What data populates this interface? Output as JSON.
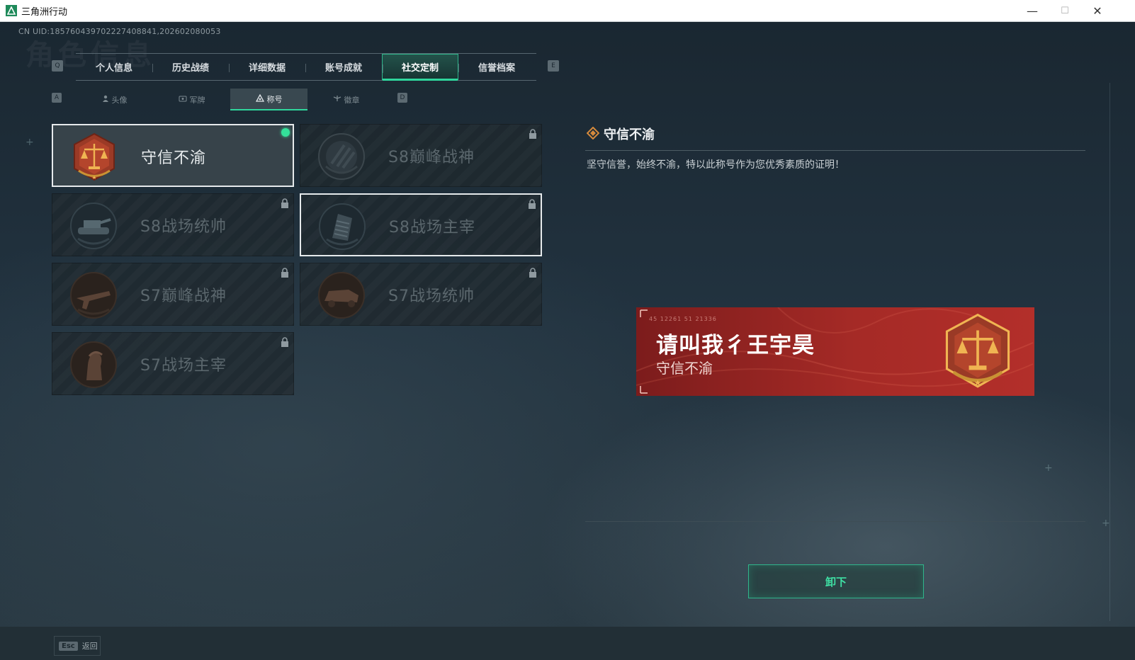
{
  "window": {
    "title": "三角洲行动",
    "minimize": "—",
    "maximize": "☐",
    "close": "✕"
  },
  "uid": "CN UID:185760439702227408841,202602080053",
  "watermark": "角色信息",
  "top_tabs": {
    "key_left": "Q",
    "key_right": "E",
    "items": [
      {
        "label": "个人信息"
      },
      {
        "label": "历史战绩"
      },
      {
        "label": "详细数据"
      },
      {
        "label": "账号成就"
      },
      {
        "label": "社交定制",
        "active": true
      },
      {
        "label": "信誉档案"
      }
    ]
  },
  "sub_tabs": {
    "key_left": "A",
    "key_right": "D",
    "items": [
      {
        "label": "头像",
        "icon": "person-icon"
      },
      {
        "label": "军牌",
        "icon": "dogtag-icon"
      },
      {
        "label": "称号",
        "icon": "badge-triangle-icon",
        "active": true
      },
      {
        "label": "徽章",
        "icon": "emblem-icon"
      }
    ]
  },
  "titles": [
    {
      "name": "守信不渝",
      "medal": "scales-medal-icon",
      "equipped": true,
      "locked": false
    },
    {
      "name": "S8巅峰战神",
      "medal": "stripes-medal-icon",
      "locked": true
    },
    {
      "name": "S8战场统帅",
      "medal": "tank-medal-icon",
      "locked": true
    },
    {
      "name": "S8战场主宰",
      "medal": "building-medal-icon",
      "locked": true,
      "hovered": true
    },
    {
      "name": "S7巅峰战神",
      "medal": "rifle-medal-icon",
      "locked": true
    },
    {
      "name": "S7战场统帅",
      "medal": "vehicle-medal-icon",
      "locked": true
    },
    {
      "name": "S7战场主宰",
      "medal": "soldier-medal-icon",
      "locked": true
    }
  ],
  "detail": {
    "title": "守信不渝",
    "description": "坚守信誉，始终不渝，特以此称号作为您优秀素质的证明！"
  },
  "nameplate": {
    "player_name": "请叫我彳王宇昊",
    "title": "守信不渝",
    "coords": "45 12261   51 21336"
  },
  "actions": {
    "unequip": "卸下"
  },
  "footer": {
    "esc_key": "Esc",
    "esc_label": "返回"
  },
  "colors": {
    "accent": "#2fd79c",
    "plate_red": "#a52a26",
    "medal_gold": "#d89a3a"
  }
}
